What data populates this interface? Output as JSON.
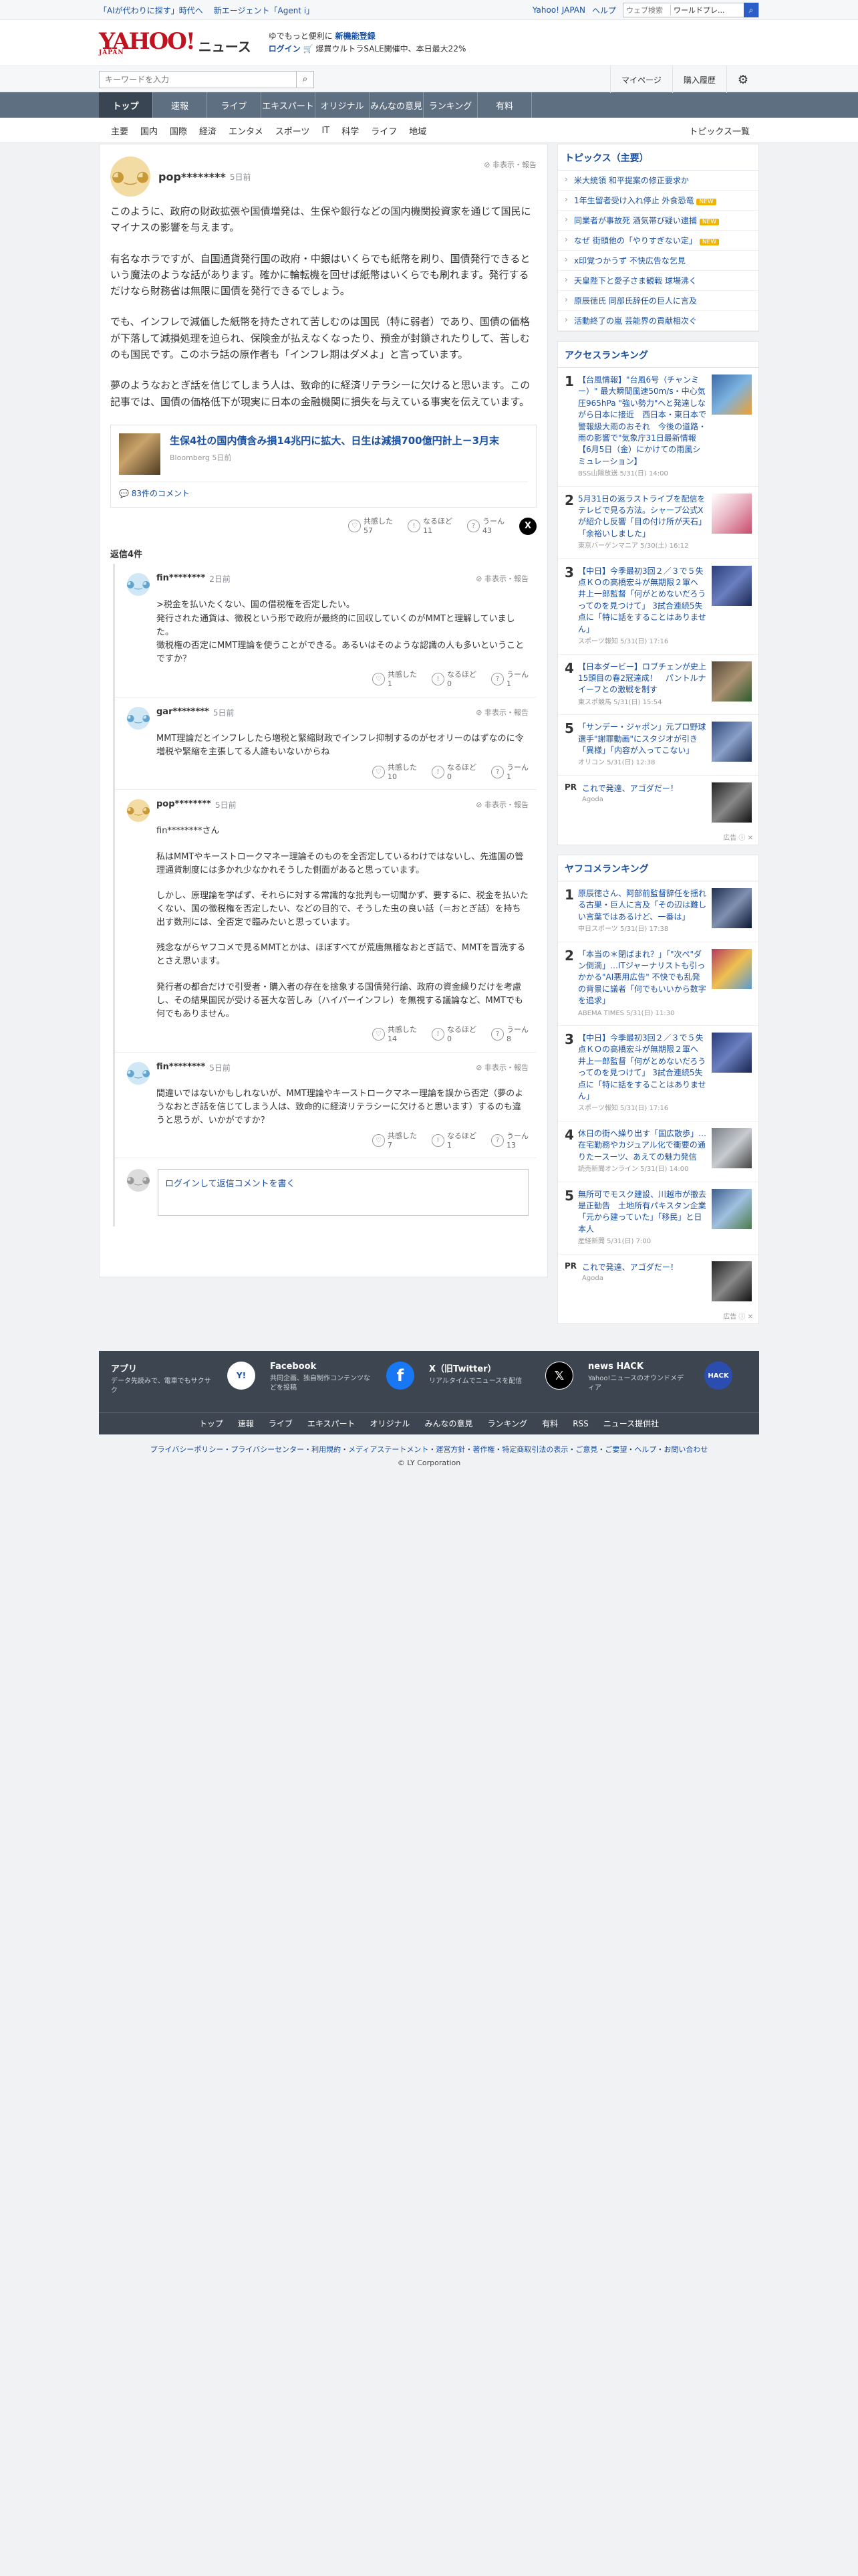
{
  "topbar": {
    "links": [
      "「AIが代わりに探す」時代へ",
      "新エージェント「Agent i」"
    ],
    "right": [
      "Yahoo! JAPAN",
      "ヘルプ"
    ],
    "search_placeholder": "ウェブ検索",
    "search_scope": "ワールドプレ..."
  },
  "header": {
    "logo": "YAHOO!",
    "logo_sub": "JAPAN",
    "brand": "ニュース",
    "promo1_pre": "ゆでもっと便利に",
    "promo1_b": "新機能登録",
    "promo2_login": "ログイン",
    "promo2": "🛒 爆買ウルトラSALE開催中、本日最大22%"
  },
  "search": {
    "placeholder": "キーワードを入力",
    "mypage": "マイページ",
    "history": "購入履歴"
  },
  "nav": [
    "トップ",
    "速報",
    "ライブ",
    "エキスパート",
    "オリジナル",
    "みんなの意見",
    "ランキング",
    "有料"
  ],
  "subnav": [
    "主要",
    "国内",
    "国際",
    "経済",
    "エンタメ",
    "スポーツ",
    "IT",
    "科学",
    "ライフ",
    "地域"
  ],
  "subnav_all": "トピックス一覧",
  "main_comment": {
    "user": "pop********",
    "time": "5日前",
    "report": "非表示・報告",
    "paragraphs": [
      "このように、政府の財政拡張や国債増発は、生保や銀行などの国内機関投資家を通じて国民にマイナスの影響を与えます。",
      "有名なホラですが、自国通貨発行国の政府・中銀はいくらでも紙幣を刷り、国債発行できるという魔法のような話があります。確かに輪転機を回せば紙幣はいくらでも刷れます。発行するだけなら財務省は無限に国債を発行できるでしょう。",
      "でも、インフレで減価した紙幣を持たされて苦しむのは国民（特に弱者）であり、国債の価格が下落して減損処理を迫られ、保険金が払えなくなったり、預金が封鎖されたりして、苦しむのも国民です。このホラ話の原作者も「インフレ期はダメよ」と言っています。",
      "夢のようなおとぎ話を信じてしまう人は、致命的に経済リテラシーに欠けると思います。この記事では、国債の価格低下が現実に日本の金融機関に損失を与えている事実を伝えています。"
    ],
    "card": {
      "title": "生保4社の国内債含み損14兆円に拡大、日生は減損700億円計上－3月末",
      "source": "Bloomberg 5日前",
      "count": "83件のコメント"
    },
    "reacts": [
      {
        "l": "共感した",
        "n": "57"
      },
      {
        "l": "なるほど",
        "n": "11"
      },
      {
        "l": "うーん",
        "n": "43"
      }
    ]
  },
  "replies_label": "返信4件",
  "replies": [
    {
      "user": "fin********",
      "time": "2日前",
      "avatar": "blue",
      "paras": [
        ">税金を払いたくない、国の借税権を否定したい。\n発行された通貨は、徴税という形で政府が最終的に回収していくのがMMTと理解していました。\n徴税権の否定にMMT理論を使うことができる。あるいはそのような認識の人も多いということですか？"
      ],
      "reacts": [
        {
          "l": "共感した",
          "n": "1"
        },
        {
          "l": "なるほど",
          "n": "0"
        },
        {
          "l": "うーん",
          "n": "1"
        }
      ]
    },
    {
      "user": "gar********",
      "time": "5日前",
      "avatar": "blue",
      "paras": [
        "MMT理論だとインフレしたら増税と緊縮財政でインフレ抑制するのがセオリーのはずなのに令増税や緊縮を主張してる人誰もいないからね"
      ],
      "reacts": [
        {
          "l": "共感した",
          "n": "10"
        },
        {
          "l": "なるほど",
          "n": "0"
        },
        {
          "l": "うーん",
          "n": "1"
        }
      ]
    },
    {
      "user": "pop********",
      "time": "5日前",
      "avatar": "yellow",
      "paras": [
        "fin********さん",
        "私はMMTやキーストロークマネー理論そのものを全否定しているわけではないし、先進国の管理通貨制度には多かれ少なかれそうした側面があると思っています。",
        "しかし、原理論を学ばず、それらに対する常識的な批判も一切聞かず、要するに、税金を払いたくない、国の徴税権を否定したい、などの目的で、そうした虫の良い話（＝おとぎ話）を持ち出す数刑には、全否定で臨みたいと思っています。",
        "残念ながらヤフコメで見るMMTとかは、ほぼすべてが荒唐無稽なおとぎ話で、MMTを冒涜するとさえ思います。",
        "発行者の都合だけで引受者・購入者の存在を捨象する国債発行論、政府の資金繰りだけを考慮し、その結果国民が受ける甚大な苦しみ（ハイパーインフレ）を無視する議論など、MMTでも何でもありません。"
      ],
      "reacts": [
        {
          "l": "共感した",
          "n": "14"
        },
        {
          "l": "なるほど",
          "n": "0"
        },
        {
          "l": "うーん",
          "n": "8"
        }
      ]
    },
    {
      "user": "fin********",
      "time": "5日前",
      "avatar": "blue",
      "paras": [
        "間違いではないかもしれないが、MMT理論やキーストロークマネー理論を誤から否定（夢のようなおとぎ話を信じてしまう人は、致命的に経済リテラシーに欠けると思います）するのも違うと思うが、いかがですか？"
      ],
      "reacts": [
        {
          "l": "共感した",
          "n": "7"
        },
        {
          "l": "なるほど",
          "n": "1"
        },
        {
          "l": "うーん",
          "n": "13"
        }
      ]
    }
  ],
  "login_prompt": "ログインして返信コメントを書く",
  "login_link": "ログイン",
  "side": {
    "topics_title": "トピックス（主要）",
    "topics": [
      {
        "t": "米大統領 和平提案の修正要求か",
        "new": ""
      },
      {
        "t": "1年生留者受け入れ停止 外食恐竜",
        "new": "NEW"
      },
      {
        "t": "同業者が事故死 酒気帯び疑い逮捕",
        "new": "NEW"
      },
      {
        "t": "なぜ 街頭他の「やりすぎない定」",
        "new": "NEW"
      },
      {
        "t": "x印覚つかうず 不快広告な乞見",
        "new": ""
      },
      {
        "t": "天皇陛下と愛子さま観戦 球場沸く",
        "new": ""
      },
      {
        "t": "原辰徳氏 同部氏辞任の巨人に言及",
        "new": ""
      },
      {
        "t": "活動終了の嵐 芸能界の貢献相次ぐ",
        "new": ""
      }
    ],
    "access_title": "アクセスランキング",
    "access": [
      {
        "n": "1",
        "t": "【台風情報】\"台風6号（チャンミー）\" 最大瞬間風速50m/s・中心気圧965hPa \"強い勢力\"へと発達しながら日本に接近　西日本・東日本で警報級大雨のおそれ　今後の道路・雨の影響で\"気象庁31日最新情報【6月5日（金）にかけての雨風シミュレーション】",
        "s": "BSS山陽放送 5/31(日) 14:00",
        "c": "#3d6aa8"
      },
      {
        "n": "2",
        "t": "5月31日の返ラストライブを配信をテレビで見る方法。シャープ公式Xが紹介し反響「目の付け所が天石」「余裕いしました」",
        "s": "東京バーゲンマニア 5/30(土) 16:12",
        "c": "#c84b6b"
      },
      {
        "n": "3",
        "t": "【中日】今季最初3回２／３で５失点ＫＯの高橋宏斗が無期限２軍へ　井上一郎監督「何がとめないだろうってのを見つけて」 3試合連続5失点に「特に話をすることはありません」",
        "s": "スポーツ報知 5/31(日) 17:16",
        "c": "#2a3d7a"
      },
      {
        "n": "4",
        "t": "【日本ダービー】ロブチェンが史上15頭目の春2冠達成！　パントルナイーフとの激戦を制す",
        "s": "東スポ競馬 5/31(日) 15:54",
        "c": "#5a4a3a"
      },
      {
        "n": "5",
        "t": "「サンデー・ジャポン」元プロ野球選手\"謝罪動画\"にスタジオが引き「異様」「内容が入ってこない」",
        "s": "オリコン 5/31(日) 12:38",
        "c": "#30487a"
      }
    ],
    "pr1": {
      "label": "PR",
      "t": "これで発達、アゴダだー！",
      "s": "Agoda"
    },
    "ad": "広告",
    "yafuko_title": "ヤフコメランキング",
    "yafuko": [
      {
        "n": "1",
        "t": "原辰徳さん、阿部前監督辞任を揺れる古巣・巨人に言及「その辺は難しい言葉ではあるけど、一番は」",
        "s": "中日スポーツ 5/31(日) 17:38",
        "c": "#1f3050"
      },
      {
        "n": "2",
        "t": "「本当の＊閉ばまれ？」「\"次ぺ\"ダン倒滴」…ITジャーナリストも引っかかる\"AI悪用広告\" 不快でも乱発の背景に議者「何でもいいから数字を追求」",
        "s": "ABEMA TIMES 5/31(日) 11:30",
        "c": "#b43a5e"
      },
      {
        "n": "3",
        "t": "【中日】今季最初3回２／３で５失点ＫＯの高橋宏斗が無期限２軍へ　井上一郎監督「何がとめないだろうってのを見つけて」 3試合連続5失点に「特に話をすることはありません」",
        "s": "スポーツ報知 5/31(日) 17:16",
        "c": "#2a3d7a"
      },
      {
        "n": "4",
        "t": "休日の街へ繰り出す「国広散歩」…在宅勤務やカジュアル化で衝要の通りたースーツ、あえての魅力発信",
        "s": "読売新聞オンライン 5/31(日) 14:00",
        "c": "#7a7f86"
      },
      {
        "n": "5",
        "t": "無所可でモスク建設、川越市が撤去是正勧告　土地所有パキスタン企業「元から建っていた」「移民」と日本人",
        "s": "産経新聞 5/31(日) 7:00",
        "c": "#3c5e8a"
      }
    ],
    "pr2": {
      "label": "PR",
      "t": "これで発達、アゴダだー！",
      "s": "Agoda"
    }
  },
  "footer": {
    "cols": [
      {
        "h": "アプリ",
        "p": "データ先読みで、電車でもサクサク",
        "icon": "Y!"
      },
      {
        "h": "Facebook",
        "p": "共同企画、独自制作コンテンツなどを投稿",
        "icon": "f"
      },
      {
        "h": "X（旧Twitter）",
        "p": "リアルタイムでニュースを配信",
        "icon": "𝕏"
      },
      {
        "h": "news HACK",
        "p": "Yahoo!ニュースのオウンドメディア",
        "icon": "HACK"
      }
    ],
    "links": [
      "トップ",
      "速報",
      "ライブ",
      "エキスパート",
      "オリジナル",
      "みんなの意見",
      "ランキング",
      "有料",
      "RSS",
      "ニュース提供社"
    ]
  },
  "legal": {
    "line1": "プライバシーポリシー・プライバシーセンター・利用規約・メディアステートメント・運営方針・著作権・特定商取引法の表示・ご意見・ご要望・ヘルプ・お問い合わせ",
    "copyright": "© LY Corporation"
  }
}
